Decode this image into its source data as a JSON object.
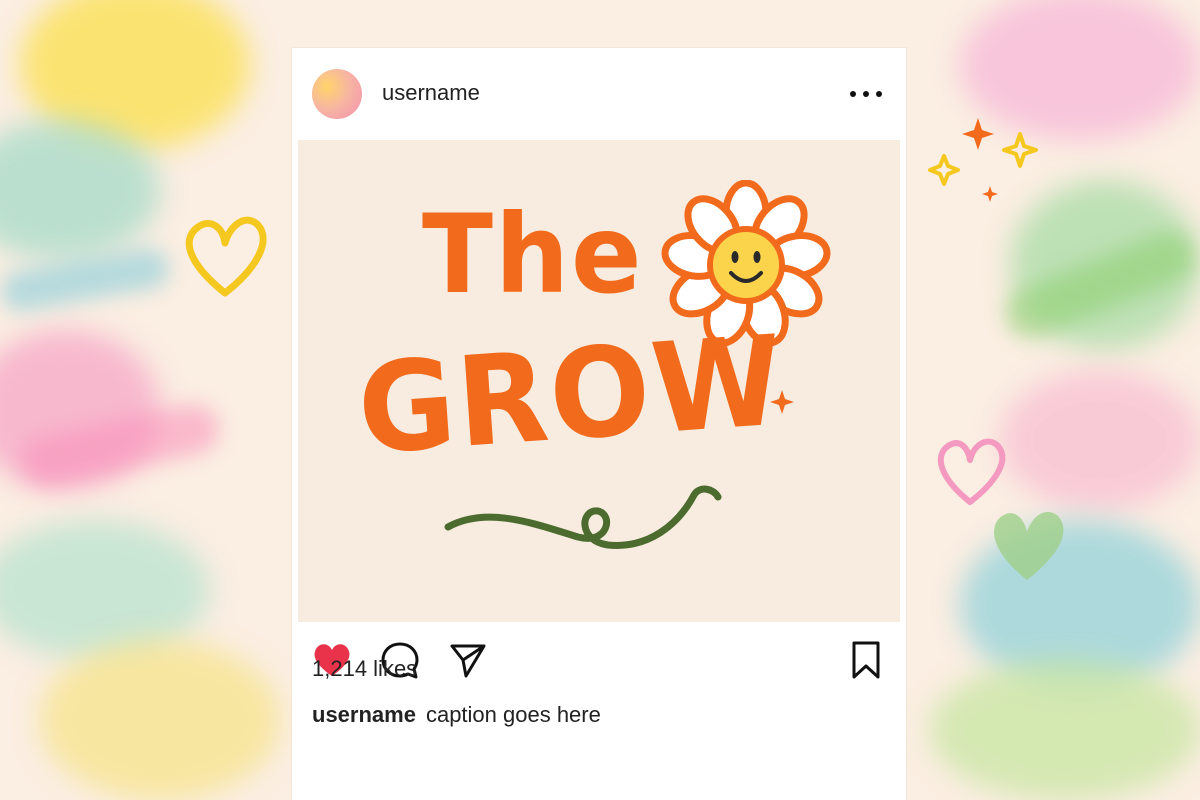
{
  "post": {
    "header": {
      "username": "username",
      "more_icon": "more-horizontal-icon"
    },
    "image": {
      "title_line1": "The",
      "title_line2": "GROW",
      "accent_color": "#f26a1b",
      "vine_color": "#4c6b2e"
    },
    "actions": {
      "like_icon": "heart-icon",
      "like_color": "#e8334a",
      "comment_icon": "comment-icon",
      "share_icon": "send-icon",
      "save_icon": "bookmark-icon"
    },
    "likes_text": "1,214 likes",
    "caption": {
      "username": "username",
      "text": "caption goes here"
    }
  }
}
